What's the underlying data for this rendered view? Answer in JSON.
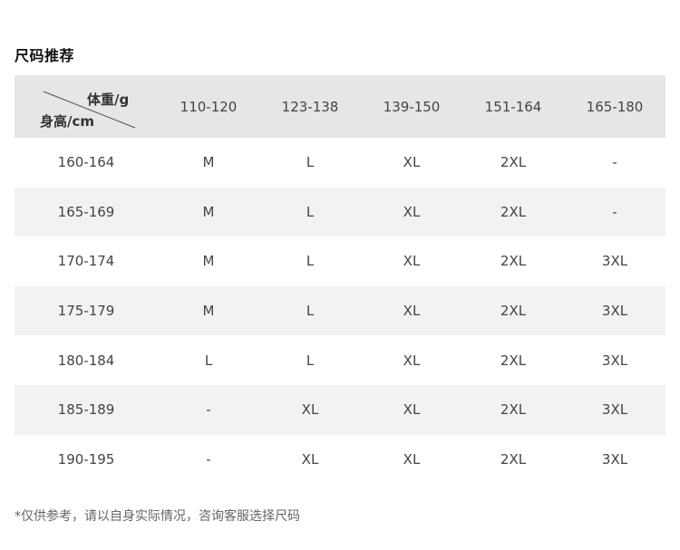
{
  "title": "尺码推荐",
  "table": {
    "corner": {
      "weight_label": "体重/g",
      "height_label": "身高/cm"
    },
    "weight_ranges": [
      "110-120",
      "123-138",
      "139-150",
      "151-164",
      "165-180"
    ],
    "rows": [
      {
        "height": "160-164",
        "sizes": [
          "M",
          "L",
          "XL",
          "2XL",
          "-"
        ]
      },
      {
        "height": "165-169",
        "sizes": [
          "M",
          "L",
          "XL",
          "2XL",
          "-"
        ]
      },
      {
        "height": "170-174",
        "sizes": [
          "M",
          "L",
          "XL",
          "2XL",
          "3XL"
        ]
      },
      {
        "height": "175-179",
        "sizes": [
          "M",
          "L",
          "XL",
          "2XL",
          "3XL"
        ]
      },
      {
        "height": "180-184",
        "sizes": [
          "L",
          "L",
          "XL",
          "2XL",
          "3XL"
        ]
      },
      {
        "height": "185-189",
        "sizes": [
          "-",
          "XL",
          "XL",
          "2XL",
          "3XL"
        ]
      },
      {
        "height": "190-195",
        "sizes": [
          "-",
          "XL",
          "XL",
          "2XL",
          "3XL"
        ]
      }
    ]
  },
  "footnote": "*仅供参考，请以自身实际情况，咨询客服选择尺码",
  "colors": {
    "header_bg": "#e6e6e6",
    "stripe_bg": "#f2f2f2",
    "text": "#444444"
  }
}
